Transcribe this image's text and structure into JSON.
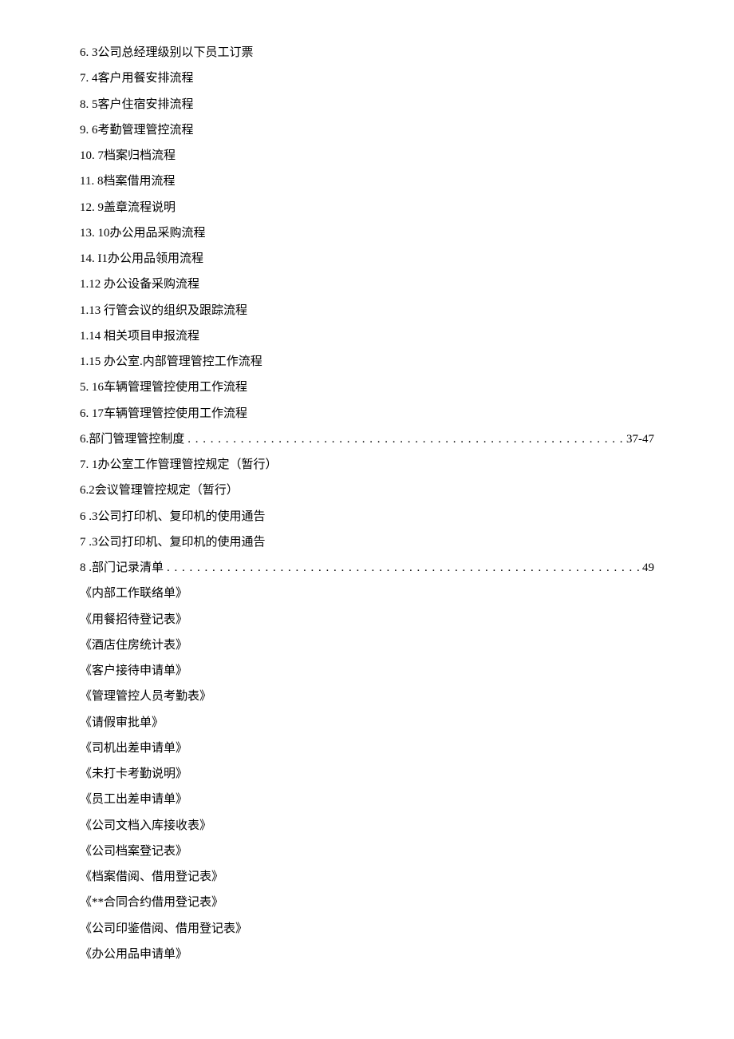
{
  "lines": [
    {
      "type": "plain",
      "text": "6. 3公司总经理级别以下员工订票"
    },
    {
      "type": "plain",
      "text": "7. 4客户用餐安排流程"
    },
    {
      "type": "plain",
      "text": "8. 5客户住宿安排流程"
    },
    {
      "type": "plain",
      "text": "9. 6考勤管理管控流程"
    },
    {
      "type": "plain",
      "text": "10.   7档案归档流程"
    },
    {
      "type": "plain",
      "text": "11.   8档案借用流程"
    },
    {
      "type": "plain",
      "text": "12.   9盖章流程说明"
    },
    {
      "type": "plain",
      "text": "13.   10办公用品采购流程"
    },
    {
      "type": "plain",
      "text": "14.   I1办公用品领用流程"
    },
    {
      "type": "plain",
      "text": "1.12  办公设备采购流程"
    },
    {
      "type": "plain",
      "text": "1.13  行管会议的组织及跟踪流程"
    },
    {
      "type": "plain",
      "text": "1.14  相关项目申报流程"
    },
    {
      "type": "plain",
      "text": "1.15  办公室.内部管理管控工作流程"
    },
    {
      "type": "plain",
      "text": "5. 16车辆管理管控使用工作流程"
    },
    {
      "type": "plain",
      "text": "6. 17车辆管理管控使用工作流程"
    },
    {
      "type": "dotted",
      "text": "6.部门管理管控制度 ",
      "page": "37-47"
    },
    {
      "type": "plain",
      "text": "7. 1办公室工作管理管控规定（暂行）"
    },
    {
      "type": "plain",
      "text": "6.2会议管理管控规定（暂行）"
    },
    {
      "type": "plain",
      "text": "6 .3公司打印机、复印机的使用通告"
    },
    {
      "type": "plain",
      "text": "7 .3公司打印机、复印机的使用通告"
    },
    {
      "type": "dotted",
      "text": "8 .部门记录清单 ",
      "page": " 49"
    },
    {
      "type": "plain",
      "text": "《内部工作联络单》"
    },
    {
      "type": "plain",
      "text": "《用餐招待登记表》"
    },
    {
      "type": "plain",
      "text": "《酒店住房统计表》"
    },
    {
      "type": "plain",
      "text": "《客户接待申请单》"
    },
    {
      "type": "plain",
      "text": "《管理管控人员考勤表》"
    },
    {
      "type": "plain",
      "text": "《请假审批单》"
    },
    {
      "type": "plain",
      "text": "《司机出差申请单》"
    },
    {
      "type": "plain",
      "text": "《未打卡考勤说明》"
    },
    {
      "type": "plain",
      "text": "《员工出差申请单》"
    },
    {
      "type": "plain",
      "text": "《公司文档入库接收表》"
    },
    {
      "type": "plain",
      "text": "《公司档案登记表》"
    },
    {
      "type": "plain",
      "text": "《档案借阅、借用登记表》"
    },
    {
      "type": "plain",
      "text": "《**合同合约借用登记表》"
    },
    {
      "type": "plain",
      "text": "《公司印鉴借阅、借用登记表》"
    },
    {
      "type": "plain",
      "text": "《办公用品申请单》"
    }
  ]
}
